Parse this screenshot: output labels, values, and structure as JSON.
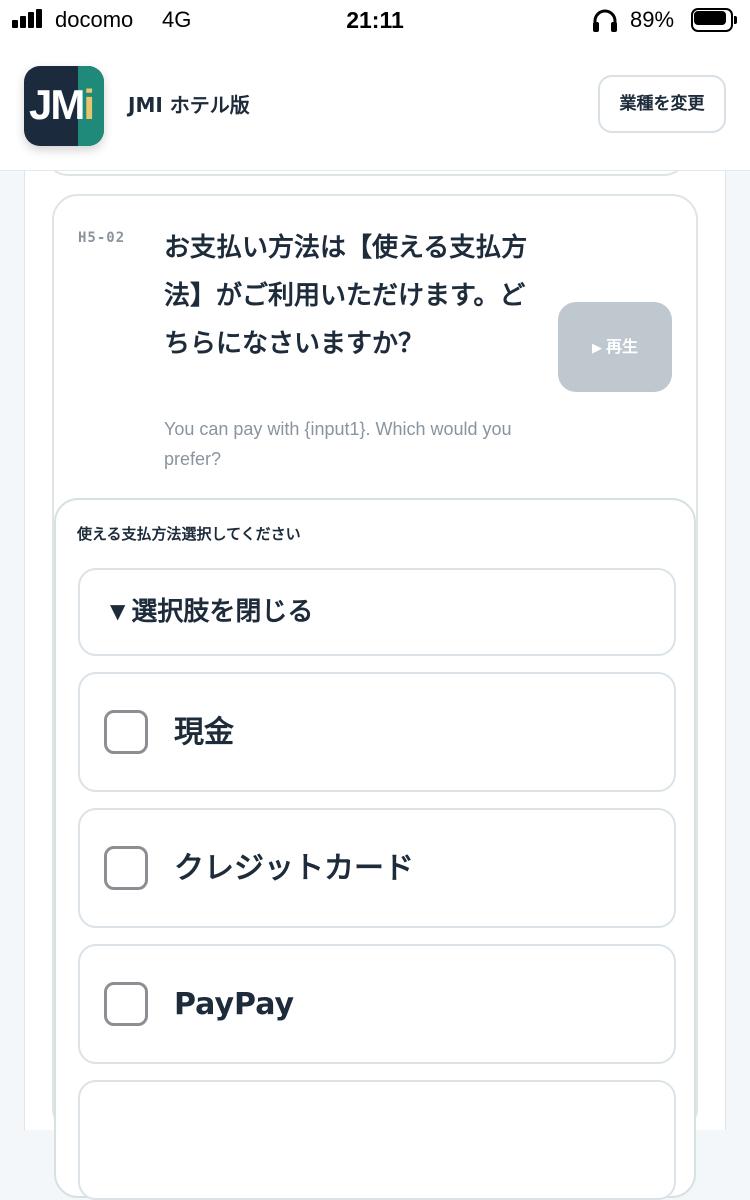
{
  "status_bar": {
    "carrier": "docomo",
    "network": "4G",
    "time": "21:11",
    "battery_percent": "89%",
    "battery_level": 0.89
  },
  "header": {
    "logo_text": "JM",
    "logo_text_accent": "i",
    "title": "JMI ホテル版",
    "change_button": "業種を変更"
  },
  "phrase": {
    "code": "H5-02",
    "japanese": "お支払い方法は【使える支払方法】がご利用いただけます。どちらになさいますか？",
    "english": "You can pay with {input1}. Which would you prefer?",
    "play_icon": "▶",
    "play_label": "再生"
  },
  "selector": {
    "title": "使える支払方法選択してください",
    "toggle_icon": "▼",
    "toggle_label": "選択肢を閉じる",
    "options": [
      {
        "label": "現金",
        "checked": false
      },
      {
        "label": "クレジットカード",
        "checked": false
      },
      {
        "label": "PayPay",
        "checked": false
      },
      {
        "label": "",
        "checked": false
      }
    ]
  },
  "colors": {
    "accent_teal": "#1f8a7a",
    "logo_navy": "#1b2b3d",
    "logo_yellow": "#e9c66a",
    "play_disabled": "#bfc8cf",
    "text_dark": "#1d2b3a",
    "text_muted": "#8a949e"
  }
}
